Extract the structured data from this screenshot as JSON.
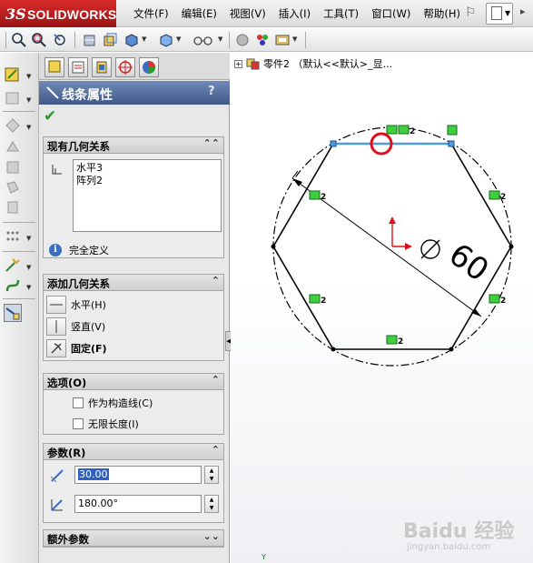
{
  "app": {
    "brand": "SOLIDWORKS",
    "brand_prefix": "3S"
  },
  "menu": [
    "文件(F)",
    "编辑(E)",
    "视图(V)",
    "插入(I)",
    "工具(T)",
    "窗口(W)",
    "帮助(H)"
  ],
  "toolbar_icons": [
    "zoom-fit-icon",
    "zoom-area-icon",
    "previous-view-icon",
    "section-view-icon",
    "view-orientation-icon",
    "display-style-icon",
    "hide-show-icon",
    "edit-appearance-icon",
    "apply-scene-icon",
    "view-settings-icon"
  ],
  "property_manager": {
    "title": "线条属性",
    "help": "?",
    "existing_relations": {
      "header": "现有几何关系",
      "items": [
        "水平3",
        "阵列2"
      ],
      "status": "完全定义"
    },
    "add_relations": {
      "header": "添加几何关系",
      "items": [
        {
          "label": "水平(H)",
          "icon": "horizontal-icon",
          "bold": false
        },
        {
          "label": "竖直(V)",
          "icon": "vertical-icon",
          "bold": false
        },
        {
          "label": "固定(F)",
          "icon": "fix-icon",
          "bold": true
        }
      ]
    },
    "options": {
      "header": "选项(O)",
      "checkboxes": [
        {
          "label": "作为构造线(C)",
          "checked": false
        },
        {
          "label": "无限长度(I)",
          "checked": false
        }
      ]
    },
    "parameters": {
      "header": "参数(R)",
      "length_value": "30.00",
      "angle_value": "180.00°"
    },
    "extra_params": {
      "header": "额外参数"
    }
  },
  "graphics": {
    "tree_label": "零件2 （默认<<默认>_显...",
    "dimension_label": "60",
    "relation_glyph": "2",
    "axis_y": "Y",
    "watermark": "Baidu 经验",
    "watermark_url": "jingyan.baidu.com"
  }
}
